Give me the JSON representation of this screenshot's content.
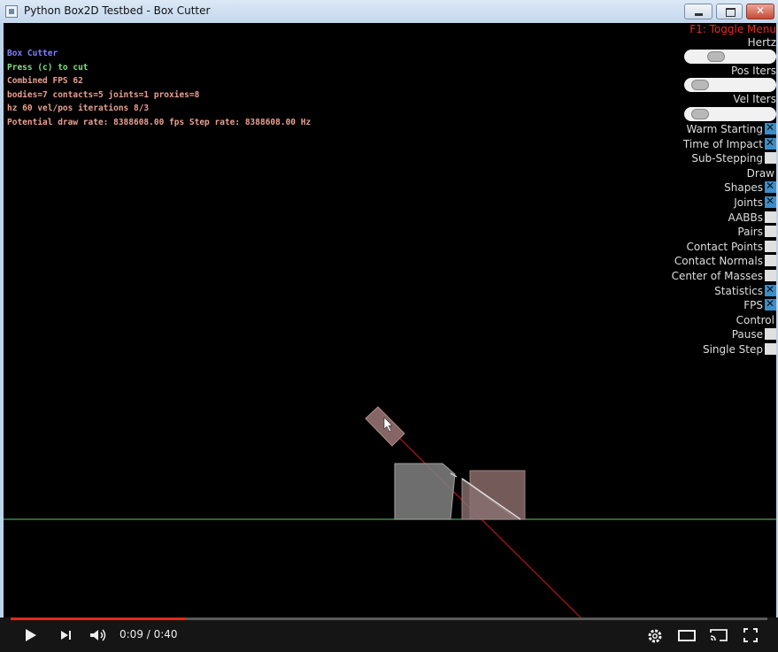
{
  "window": {
    "title": "Python Box2D Testbed - Box Cutter",
    "icon": "app-icon"
  },
  "info": [
    {
      "text": "Box Cutter",
      "color": "#8080ff"
    },
    {
      "text": "Press (c) to cut",
      "color": "#80e080"
    },
    {
      "text": "Combined FPS 62",
      "color": "#e8a090"
    },
    {
      "text": "bodies=7 contacts=5 joints=1 proxies=8",
      "color": "#e8a090"
    },
    {
      "text": "hz 60 vel/pos iterations 8/3",
      "color": "#e8a090"
    },
    {
      "text": "Potential draw rate: 8388608.00 fps Step rate: 8388608.00 Hz",
      "color": "#e8a090"
    }
  ],
  "menu": {
    "toggle": "F1: Toggle Menu",
    "sliders": [
      {
        "label": "Hertz",
        "value": 0.27
      },
      {
        "label": "Pos Iters",
        "value": 0.05
      },
      {
        "label": "Vel Iters",
        "value": 0.05
      }
    ],
    "options": [
      {
        "label": "Warm Starting",
        "checked": true,
        "checkbox": true
      },
      {
        "label": "Time of Impact",
        "checked": true,
        "checkbox": true
      },
      {
        "label": "Sub-Stepping",
        "checked": false,
        "checkbox": true
      },
      {
        "label": "Draw",
        "checked": false,
        "checkbox": false
      },
      {
        "label": "Shapes",
        "checked": true,
        "checkbox": true
      },
      {
        "label": "Joints",
        "checked": true,
        "checkbox": true
      },
      {
        "label": "AABBs",
        "checked": false,
        "checkbox": true
      },
      {
        "label": "Pairs",
        "checked": false,
        "checkbox": true
      },
      {
        "label": "Contact Points",
        "checked": false,
        "checkbox": true
      },
      {
        "label": "Contact Normals",
        "checked": false,
        "checkbox": true
      },
      {
        "label": "Center of Masses",
        "checked": false,
        "checkbox": true
      },
      {
        "label": "Statistics",
        "checked": true,
        "checkbox": true
      },
      {
        "label": "FPS",
        "checked": true,
        "checkbox": true
      },
      {
        "label": "Control",
        "checked": false,
        "checkbox": false
      },
      {
        "label": "Pause",
        "checked": false,
        "checkbox": true
      },
      {
        "label": "Single Step",
        "checked": false,
        "checkbox": true
      }
    ]
  },
  "player": {
    "time": "0:09 / 0:40",
    "progress": 0.231,
    "accent": "#e5271c",
    "icons": [
      "play-icon",
      "next-icon",
      "volume-icon",
      "settings-gear-icon",
      "theater-mode-icon",
      "cast-icon",
      "fullscreen-icon"
    ]
  }
}
